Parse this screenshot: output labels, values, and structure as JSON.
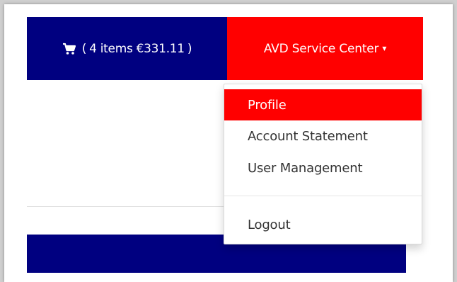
{
  "header": {
    "cart": {
      "icon": "shopping-cart-icon",
      "open_paren": "(",
      "summary": "4 items €331.11",
      "close_paren": ")"
    },
    "account": {
      "label": "AVD Service Center",
      "caret": "▾"
    }
  },
  "dropdown": {
    "items": [
      {
        "label": "Profile",
        "active": true
      },
      {
        "label": "Account Statement",
        "active": false
      },
      {
        "label": "User Management",
        "active": false
      },
      {
        "label": "Logout",
        "active": false
      }
    ]
  },
  "colors": {
    "navy": "#000080",
    "red": "#ff0000",
    "text": "#333333"
  }
}
